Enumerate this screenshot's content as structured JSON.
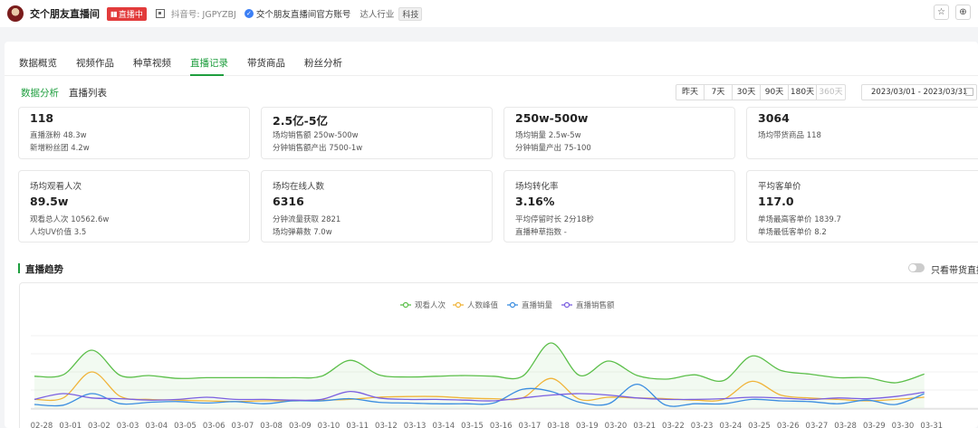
{
  "header": {
    "shop_name": "交个朋友直播间",
    "live_badge": "直播中",
    "douyin_id": "抖音号: JGPYZBJ",
    "verified_text": "交个朋友直播间官方账号",
    "industry_label": "达人行业",
    "industry_tag": "科技",
    "icons": [
      "avatar",
      "live-bars-icon",
      "qr-code-icon",
      "verified-icon",
      "star-icon",
      "add-icon"
    ]
  },
  "tabs": [
    "数据概览",
    "视频作品",
    "种草视频",
    "直播记录",
    "带货商品",
    "粉丝分析"
  ],
  "active_tab": "直播记录",
  "subtabs": [
    "数据分析",
    "直播列表"
  ],
  "active_subtab": "数据分析",
  "ranges": [
    "昨天",
    "7天",
    "30天",
    "90天",
    "180天",
    "360天"
  ],
  "date_range": "2023/03/01  -  2023/03/31",
  "stats_row1": [
    {
      "value": "118",
      "line1": "直播涨粉 48.3w",
      "line2": "新增粉丝团 4.2w"
    },
    {
      "value": "2.5亿-5亿",
      "line1": "场均销售额 250w-500w",
      "line2": "分钟销售额产出 7500-1w"
    },
    {
      "value": "250w-500w",
      "line1": "场均销量 2.5w-5w",
      "line2": "分钟销量产出 75-100"
    },
    {
      "value": "3064",
      "line1": "场均带货商品 118",
      "line2": ""
    }
  ],
  "stats_row2": [
    {
      "title": "场均观看人次",
      "value": "89.5w",
      "line1": "观看总人次 10562.6w",
      "line2": "人均UV价值 3.5"
    },
    {
      "title": "场均在线人数",
      "value": "6316",
      "line1": "分钟流量获取 2821",
      "line2": "场均弹幕数 7.0w"
    },
    {
      "title": "场均转化率",
      "value": "3.16%",
      "line1": "平均停留时长 2分18秒",
      "line2": "直播种草指数 -"
    },
    {
      "title": "平均客单价",
      "value": "117.0",
      "line1": "单场最高客单价 1839.7",
      "line2": "单场最低客单价 8.2"
    }
  ],
  "trend": {
    "title": "直播趋势",
    "toggle_label": "只看带货直播"
  },
  "chart_data": {
    "type": "line",
    "x": [
      "02-28",
      "03-01",
      "03-02",
      "03-03",
      "03-04",
      "03-05",
      "03-06",
      "03-07",
      "03-08",
      "03-09",
      "03-10",
      "03-11",
      "03-12",
      "03-13",
      "03-14",
      "03-15",
      "03-16",
      "03-17",
      "03-18",
      "03-19",
      "03-20",
      "03-21",
      "03-22",
      "03-23",
      "03-24",
      "03-25",
      "03-26",
      "03-27",
      "03-28",
      "03-29",
      "03-30",
      "03-31"
    ],
    "ylim": [
      0,
      100
    ],
    "grid": true,
    "legend_position": "top-center",
    "series": [
      {
        "name": "观看人次",
        "color": "#5cbf4a",
        "fill": true,
        "values": [
          44,
          46,
          80,
          45,
          45,
          41,
          42,
          42,
          42,
          42,
          44,
          66,
          46,
          43,
          44,
          45,
          44,
          44,
          90,
          45,
          65,
          45,
          40,
          46,
          38,
          72,
          52,
          47,
          42,
          42,
          35,
          47
        ]
      },
      {
        "name": "人数峰值",
        "color": "#f0b43a",
        "fill": false,
        "values": [
          12,
          14,
          50,
          16,
          12,
          11,
          10,
          9,
          10,
          10,
          11,
          12,
          15,
          16,
          16,
          14,
          13,
          14,
          41,
          12,
          15,
          14,
          13,
          11,
          12,
          37,
          18,
          14,
          12,
          10,
          12,
          15
        ]
      },
      {
        "name": "直播销量",
        "color": "#3b8de0",
        "fill": false,
        "values": [
          5,
          4,
          20,
          6,
          8,
          9,
          7,
          9,
          6,
          10,
          10,
          13,
          8,
          7,
          6,
          6,
          7,
          26,
          23,
          8,
          6,
          33,
          4,
          6,
          6,
          12,
          10,
          9,
          6,
          11,
          5,
          20
        ]
      },
      {
        "name": "直播销售额",
        "color": "#7b5fe0",
        "fill": false,
        "values": [
          12,
          20,
          14,
          13,
          11,
          12,
          15,
          12,
          12,
          11,
          12,
          23,
          14,
          12,
          12,
          11,
          10,
          14,
          18,
          20,
          18,
          14,
          12,
          12,
          13,
          15,
          14,
          12,
          14,
          13,
          16,
          22
        ]
      }
    ]
  }
}
